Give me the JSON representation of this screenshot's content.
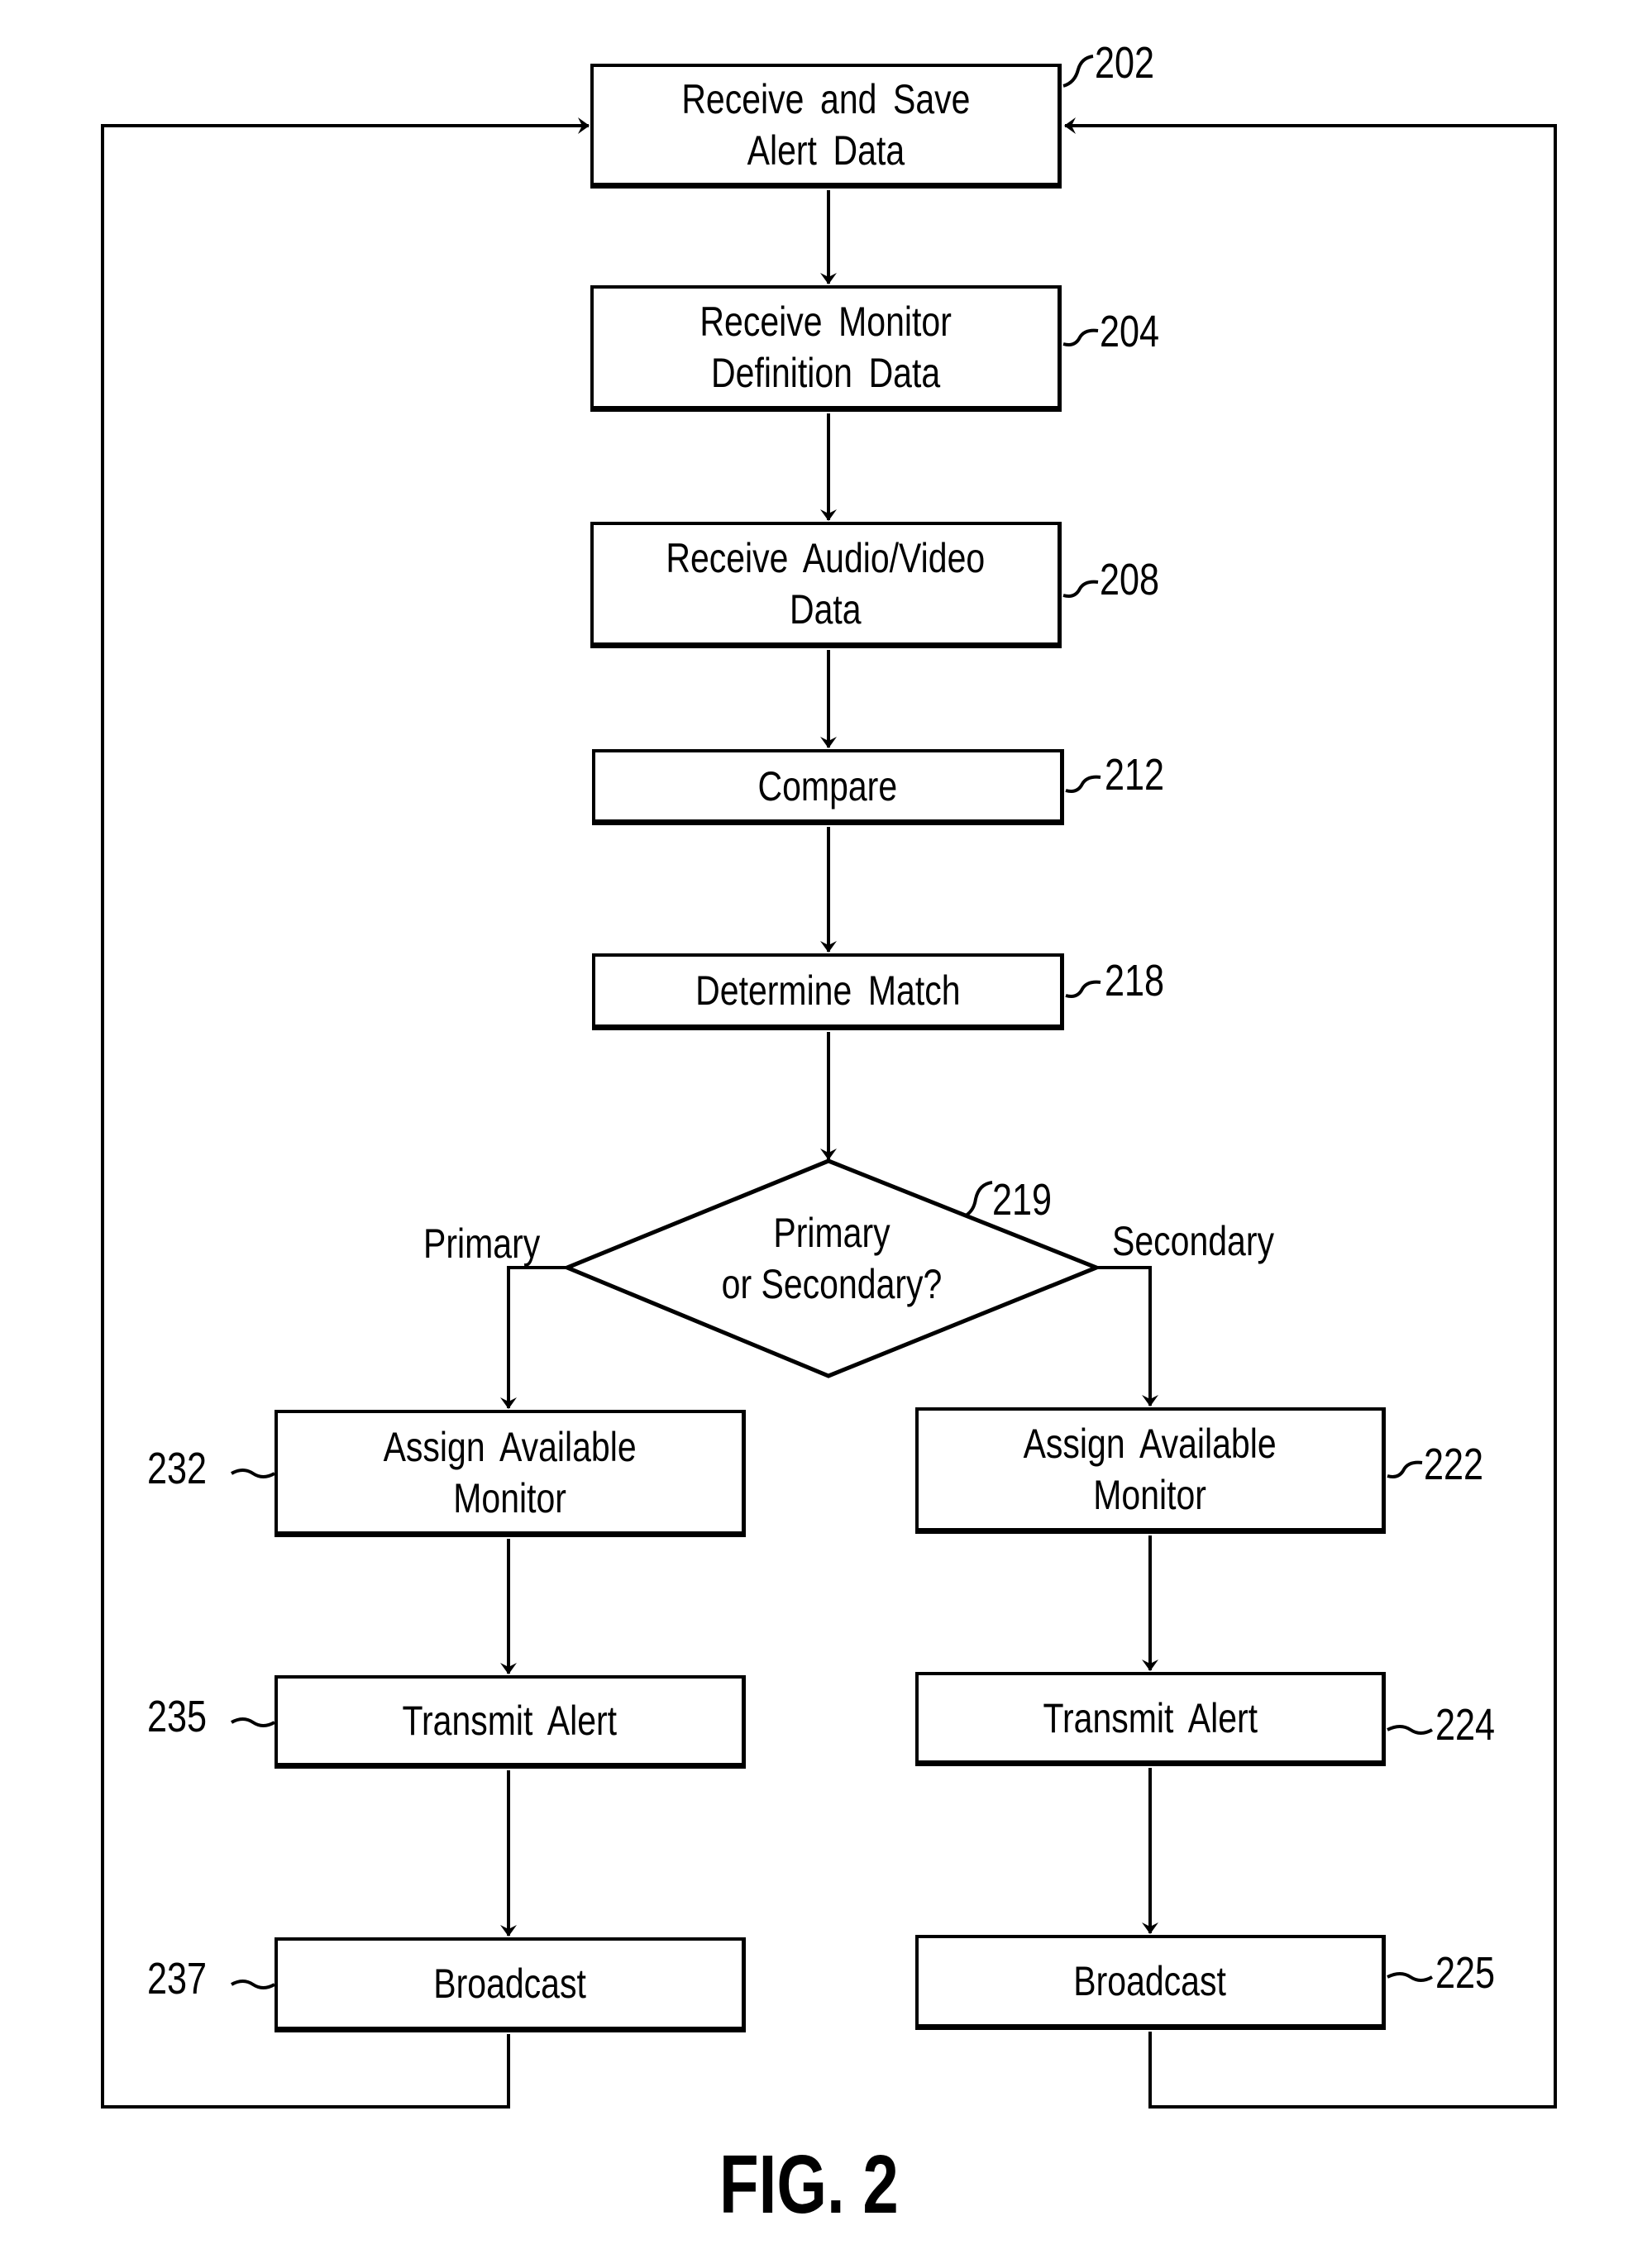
{
  "figure": {
    "caption": "FIG. 2"
  },
  "steps": {
    "s202": {
      "ref": "202",
      "label": "Receive and Save\nAlert Data"
    },
    "s204": {
      "ref": "204",
      "label": "Receive Monitor\nDefinition Data"
    },
    "s208": {
      "ref": "208",
      "label": "Receive Audio/Video\nData"
    },
    "s212": {
      "ref": "212",
      "label": "Compare"
    },
    "s218": {
      "ref": "218",
      "label": "Determine Match"
    },
    "s219": {
      "ref": "219",
      "label": "Primary\nor Secondary?"
    },
    "s232": {
      "ref": "232",
      "label": "Assign Available\nMonitor"
    },
    "s235": {
      "ref": "235",
      "label": "Transmit Alert"
    },
    "s237": {
      "ref": "237",
      "label": "Broadcast"
    },
    "s222": {
      "ref": "222",
      "label": "Assign Available\nMonitor"
    },
    "s224": {
      "ref": "224",
      "label": "Transmit Alert"
    },
    "s225": {
      "ref": "225",
      "label": "Broadcast"
    }
  },
  "branches": {
    "left": "Primary",
    "right": "Secondary"
  }
}
